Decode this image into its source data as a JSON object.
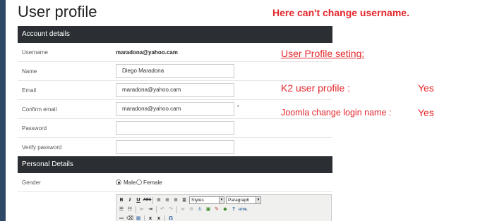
{
  "page": {
    "title": "User profile"
  },
  "sections": {
    "account": "Account details",
    "personal": "Personal Details"
  },
  "account": {
    "username": {
      "label": "Username",
      "value": "maradona@yahoo.cam"
    },
    "name": {
      "label": "Name",
      "value": "Diego Maradona"
    },
    "email": {
      "label": "Email",
      "value": "maradona@yahoo.cam"
    },
    "confirm_email": {
      "label": "Confirm email",
      "value": "maradona@yahoo.cam",
      "required_mark": "*"
    },
    "password": {
      "label": "Password",
      "value": ""
    },
    "verify_password": {
      "label": "Verify password",
      "value": ""
    }
  },
  "personal": {
    "gender": {
      "label": "Gender",
      "options": [
        "Male",
        "Female"
      ],
      "selected": "Male"
    }
  },
  "editor": {
    "styles_select": "Styles",
    "format_select": "Paragraph"
  },
  "annotations": {
    "title": "Here can't change username.",
    "setting": "User Profile seting:",
    "k2_label": "K2 user profile :",
    "k2_value": "Yes",
    "joomla_label": "Joomla change login name :",
    "joomla_value": "Yes"
  },
  "colors": {
    "section_bar": "#2b2f33",
    "annotation": "#e3262b",
    "left_strip": "#2f4a66"
  }
}
